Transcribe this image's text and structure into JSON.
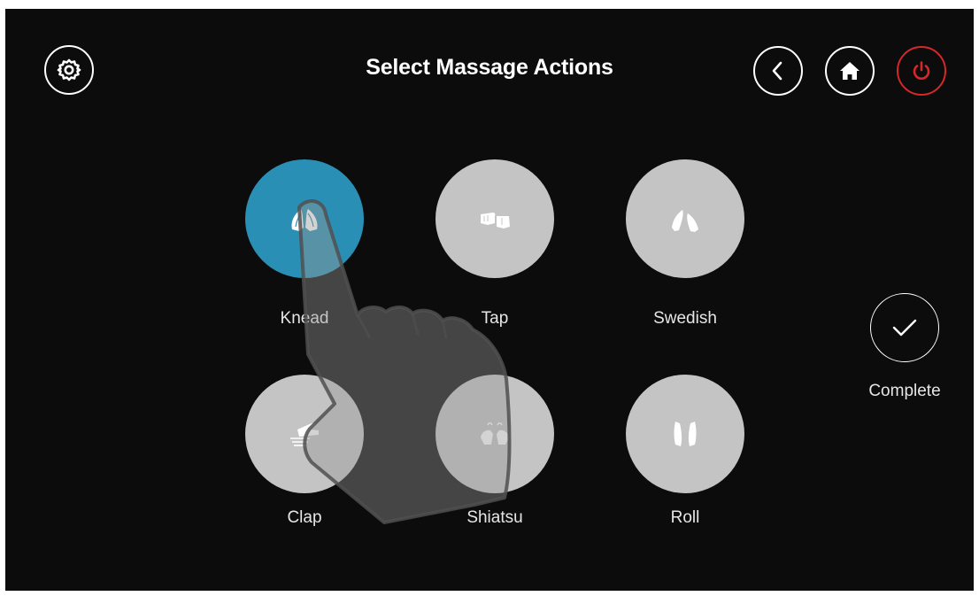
{
  "header": {
    "title": "Select Massage Actions"
  },
  "toolbar": {
    "settings_icon": "gear-icon",
    "back_icon": "chevron-left-icon",
    "home_icon": "home-icon",
    "power_icon": "power-icon"
  },
  "actions": [
    {
      "label": "Knead",
      "icon": "knead-hands-icon",
      "selected": true
    },
    {
      "label": "Tap",
      "icon": "tap-fists-icon",
      "selected": false
    },
    {
      "label": "Swedish",
      "icon": "swedish-hands-icon",
      "selected": false
    },
    {
      "label": "Clap",
      "icon": "clap-hand-icon",
      "selected": false
    },
    {
      "label": "Shiatsu",
      "icon": "shiatsu-hands-icon",
      "selected": false
    },
    {
      "label": "Roll",
      "icon": "roll-hands-icon",
      "selected": false
    }
  ],
  "complete": {
    "label": "Complete",
    "icon": "checkmark-icon"
  },
  "colors": {
    "background": "#0c0c0c",
    "selected": "#2a8fb4",
    "unselected": "#c4c4c4",
    "power": "#d62828",
    "text": "#ffffff"
  }
}
